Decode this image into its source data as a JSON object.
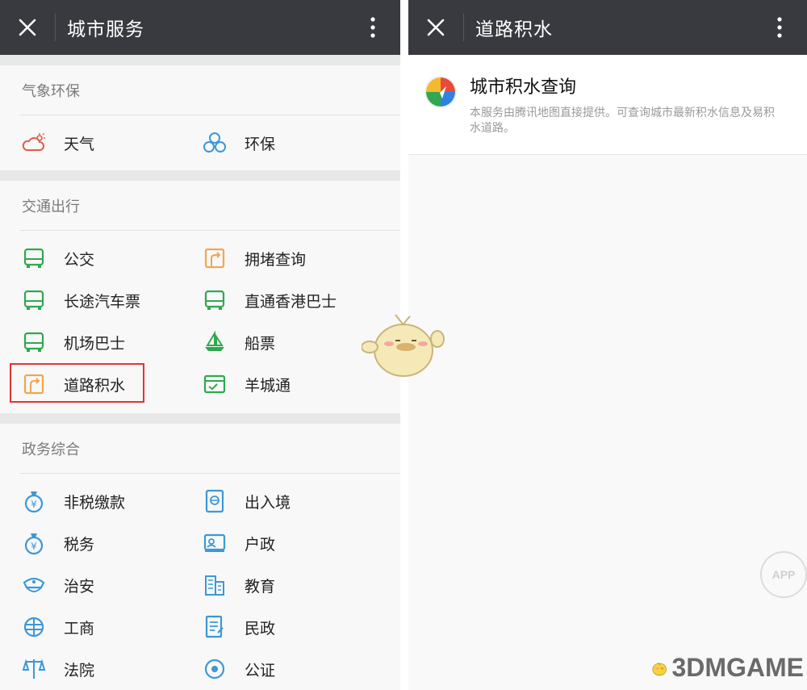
{
  "left": {
    "title": "城市服务",
    "sections": [
      {
        "heading": "气象环保",
        "items": [
          {
            "label": "天气",
            "icon": "weather-icon"
          },
          {
            "label": "环保",
            "icon": "recycle-icon"
          }
        ]
      },
      {
        "heading": "交通出行",
        "items": [
          {
            "label": "公交",
            "icon": "bus-icon"
          },
          {
            "label": "拥堵查询",
            "icon": "road-sign-icon"
          },
          {
            "label": "长途汽车票",
            "icon": "bus-icon"
          },
          {
            "label": "直通香港巴士",
            "icon": "bus-icon"
          },
          {
            "label": "机场巴士",
            "icon": "bus-icon"
          },
          {
            "label": "船票",
            "icon": "boat-icon"
          },
          {
            "label": "道路积水",
            "icon": "road-sign-icon",
            "highlighted": true
          },
          {
            "label": "羊城通",
            "icon": "card-icon"
          }
        ]
      },
      {
        "heading": "政务综合",
        "items": [
          {
            "label": "非税缴款",
            "icon": "money-bag-icon"
          },
          {
            "label": "出入境",
            "icon": "passport-icon"
          },
          {
            "label": "税务",
            "icon": "money-bag-icon"
          },
          {
            "label": "户政",
            "icon": "id-card-icon"
          },
          {
            "label": "治安",
            "icon": "police-cap-icon"
          },
          {
            "label": "教育",
            "icon": "building-icon"
          },
          {
            "label": "工商",
            "icon": "globe-icon"
          },
          {
            "label": "民政",
            "icon": "document-icon"
          },
          {
            "label": "法院",
            "icon": "scales-icon"
          },
          {
            "label": "公证",
            "icon": "seal-icon"
          }
        ]
      }
    ]
  },
  "right": {
    "title": "道路积水",
    "service": {
      "title": "城市积水查询",
      "desc": "本服务由腾讯地图直接提供。可查询城市最新积水信息及易积水道路。",
      "icon": "tencent-map-icon"
    }
  },
  "watermark": {
    "site": "3DMGAME",
    "stamp": "APP"
  },
  "colors": {
    "titlebar": "#393a3f",
    "green_icon": "#2fa84f",
    "orange_icon": "#f0a650",
    "blue_icon": "#3b98d9",
    "highlight_border": "#e23436"
  }
}
